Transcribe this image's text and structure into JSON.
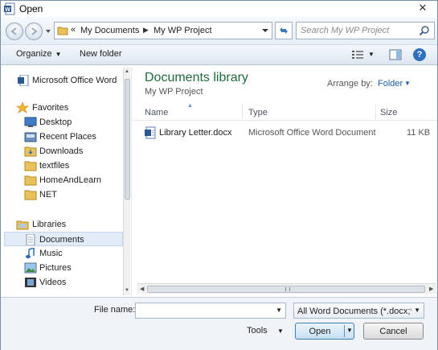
{
  "window": {
    "title": "Open",
    "close_glyph": "✕"
  },
  "address": {
    "overflow": "«",
    "crumbs": [
      "My Documents",
      "My WP Project"
    ],
    "search_placeholder": "Search My WP Project"
  },
  "toolbar": {
    "organize": "Organize",
    "new_folder": "New folder",
    "help": "?"
  },
  "nav": {
    "items": [
      {
        "label": "Microsoft Office Word",
        "icon": "word-app-icon"
      },
      {
        "label": "Favorites",
        "icon": "star-icon"
      },
      {
        "label": "Desktop",
        "icon": "desktop-icon"
      },
      {
        "label": "Recent Places",
        "icon": "recent-places-icon"
      },
      {
        "label": "Downloads",
        "icon": "downloads-folder-icon"
      },
      {
        "label": "textfiles",
        "icon": "folder-icon"
      },
      {
        "label": "HomeAndLearn",
        "icon": "folder-icon"
      },
      {
        "label": "NET",
        "icon": "folder-icon"
      },
      {
        "label": "Libraries",
        "icon": "libraries-icon"
      },
      {
        "label": "Documents",
        "icon": "documents-library-icon"
      },
      {
        "label": "Music",
        "icon": "music-icon"
      },
      {
        "label": "Pictures",
        "icon": "pictures-icon"
      },
      {
        "label": "Videos",
        "icon": "videos-icon"
      }
    ]
  },
  "main": {
    "library_title": "Documents library",
    "library_subtitle": "My WP Project",
    "arrange_label": "Arrange by:",
    "arrange_value": "Folder",
    "columns": {
      "name": "Name",
      "type": "Type",
      "size": "Size"
    },
    "files": [
      {
        "name": "Library Letter.docx",
        "type": "Microsoft Office Word Document",
        "size": "11 KB"
      }
    ]
  },
  "bottom": {
    "file_name_label": "File name:",
    "file_name_value": "",
    "filter": "All Word Documents (*.docx;*.d",
    "tools": "Tools",
    "open": "Open",
    "cancel": "Cancel"
  },
  "colors": {
    "library_title": "#1e6b3c",
    "link": "#1c5fb0",
    "selection": "#e2ecf8"
  }
}
